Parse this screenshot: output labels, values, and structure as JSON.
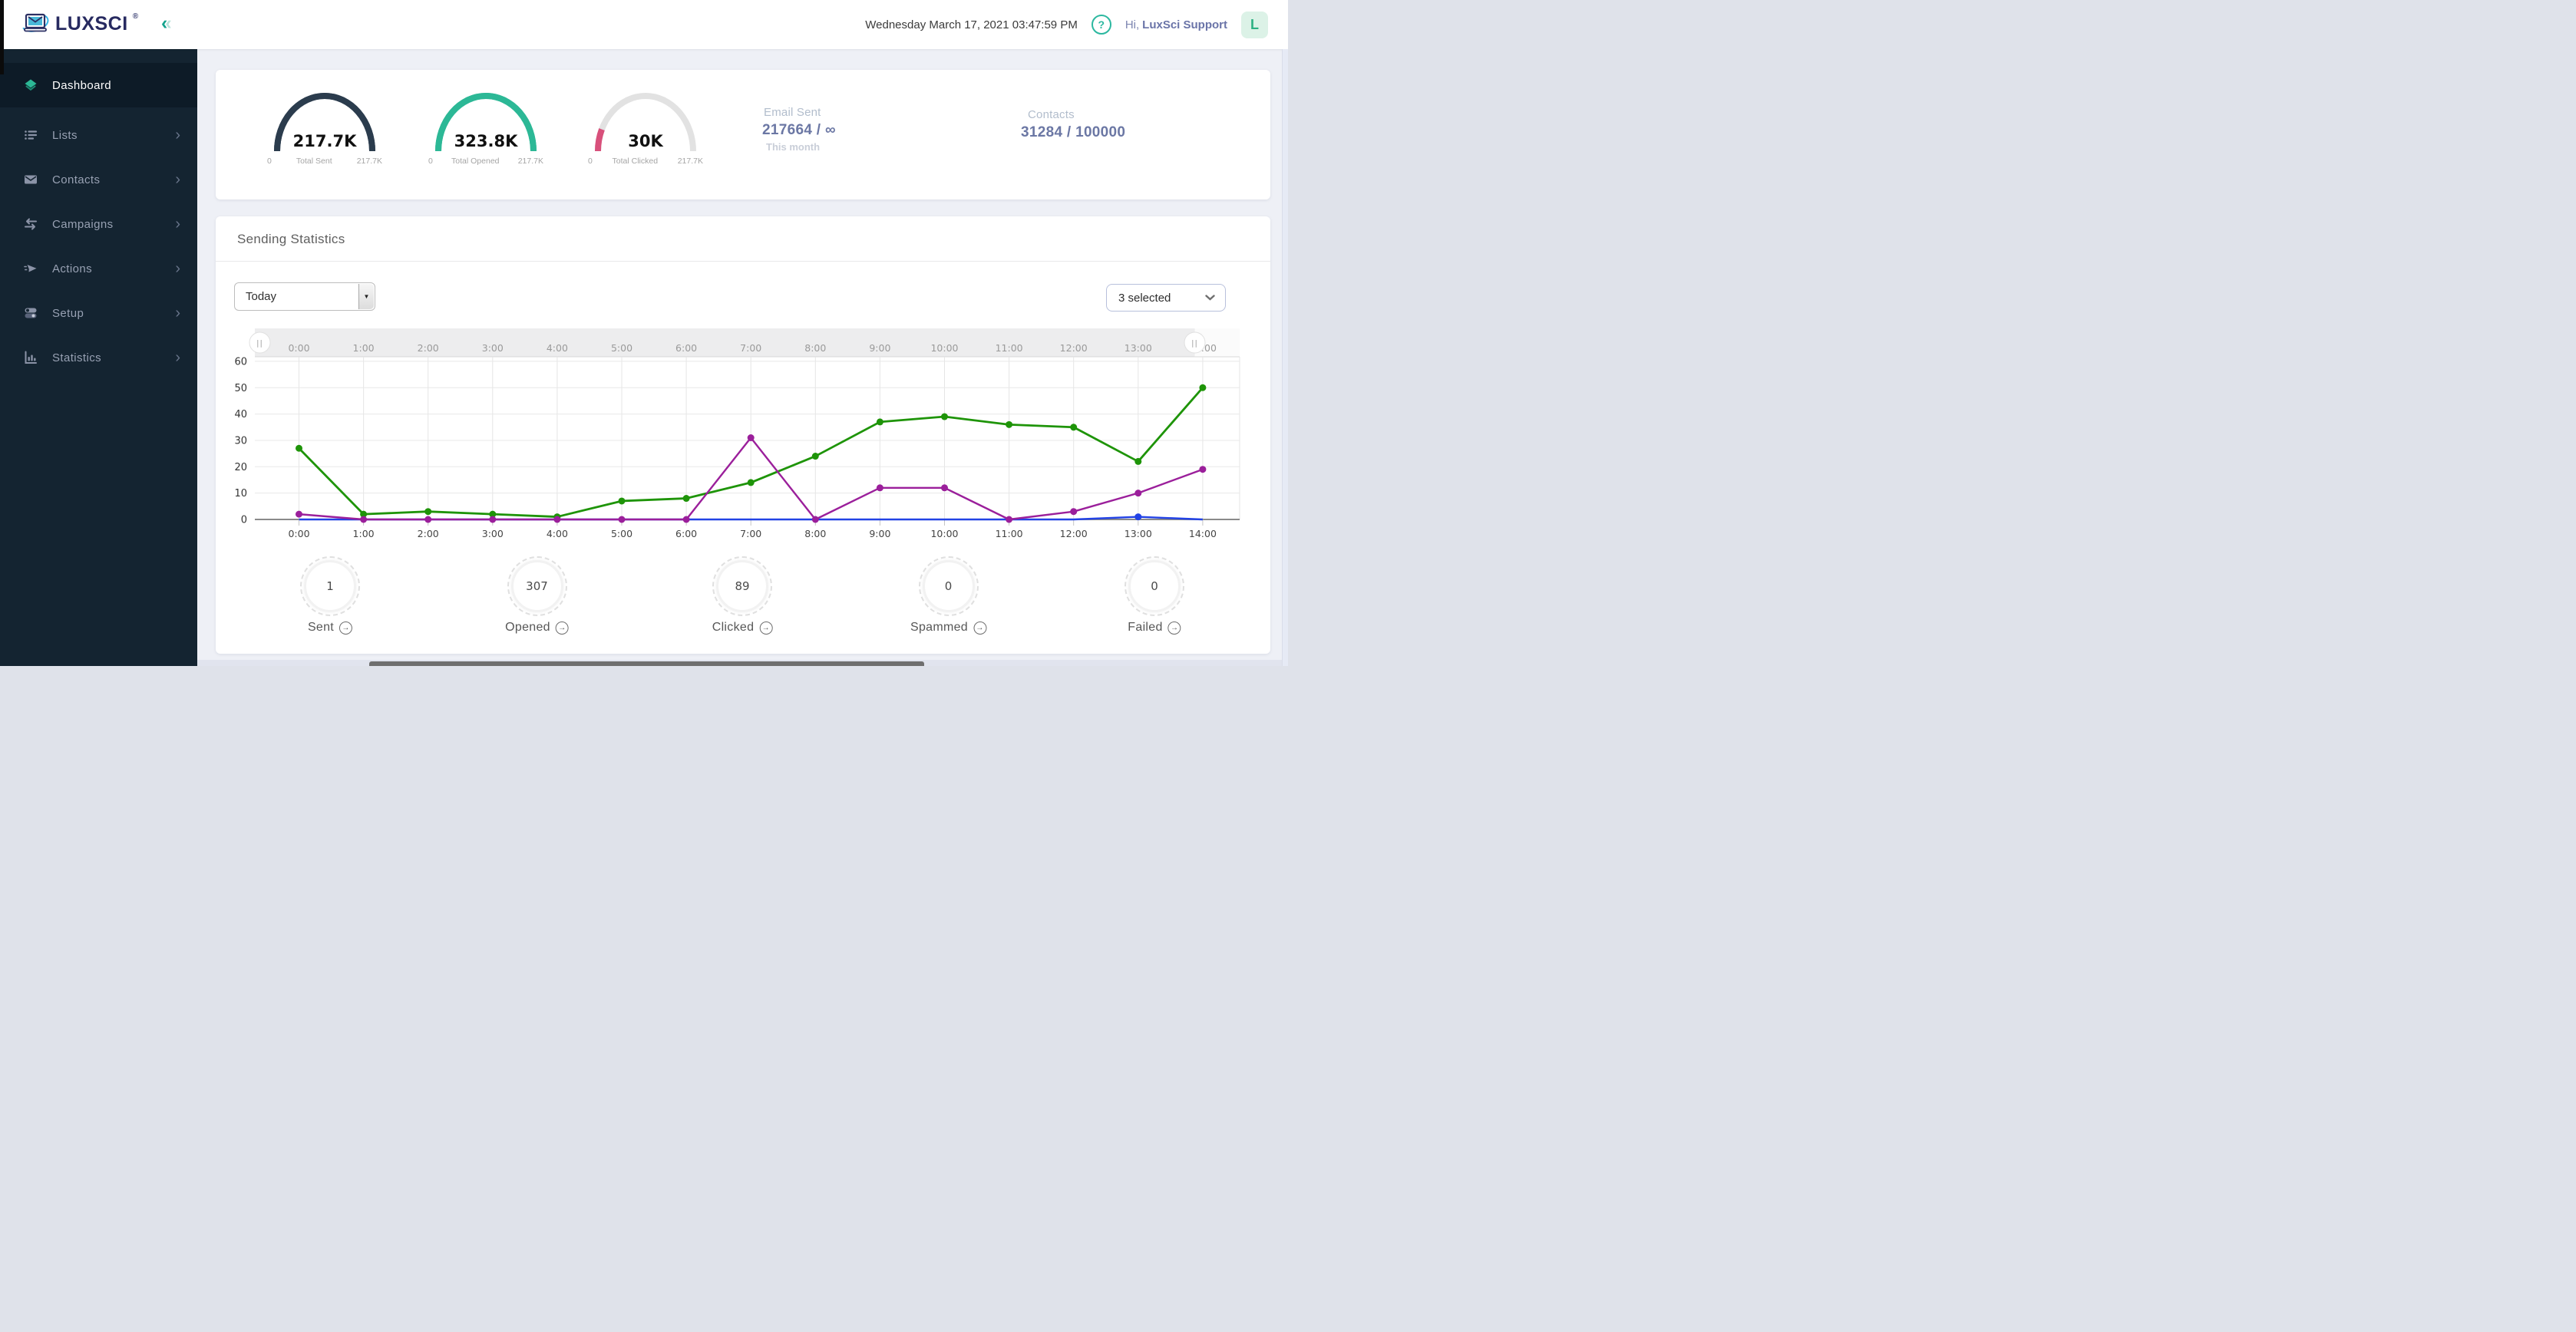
{
  "header": {
    "brand": "LUXSCI",
    "brand_reg": "®",
    "datetime": "Wednesday March 17, 2021 03:47:59 PM",
    "help_glyph": "?",
    "greeting": "Hi,",
    "username": "LuxSci Support",
    "avatar_letter": "L",
    "brand_navy": "#272a60",
    "brand_teal": "#2cb896"
  },
  "sidebar": {
    "items": [
      {
        "label": "Dashboard",
        "icon": "layers-icon",
        "active": true,
        "chevron": false
      },
      {
        "label": "Lists",
        "icon": "list-icon",
        "active": false,
        "chevron": true
      },
      {
        "label": "Contacts",
        "icon": "envelope-icon",
        "active": false,
        "chevron": true
      },
      {
        "label": "Campaigns",
        "icon": "arrows-icon",
        "active": false,
        "chevron": true
      },
      {
        "label": "Actions",
        "icon": "send-icon",
        "active": false,
        "chevron": true
      },
      {
        "label": "Setup",
        "icon": "toggles-icon",
        "active": false,
        "chevron": true
      },
      {
        "label": "Statistics",
        "icon": "chart-icon",
        "active": false,
        "chevron": true
      }
    ]
  },
  "overview": {
    "gauges": [
      {
        "value": "217.7K",
        "label": "Total Sent",
        "min": "0",
        "max": "217.7K",
        "color": "#2b3c4d",
        "track": "#2b3c4d",
        "fill_pct": 100
      },
      {
        "value": "323.8K",
        "label": "Total Opened",
        "min": "0",
        "max": "217.7K",
        "color": "#2cb896",
        "track": "#2cb896",
        "fill_pct": 100
      },
      {
        "value": "30K",
        "label": "Total Clicked",
        "min": "0",
        "max": "217.7K",
        "color": "#d8507b",
        "track": "#e2e2e2",
        "fill_pct": 13.8
      }
    ],
    "email_sent": {
      "label": "Email Sent",
      "value": "217664",
      "separator": "/",
      "quota": "∞",
      "period": "This month"
    },
    "contacts": {
      "label": "Contacts",
      "value": "31284 / 100000"
    }
  },
  "panel": {
    "title": "Sending Statistics",
    "range_select_value": "Today",
    "series_select_value": "3 selected"
  },
  "chart_data": {
    "type": "line",
    "x_labels": [
      "0:00",
      "1:00",
      "2:00",
      "3:00",
      "4:00",
      "5:00",
      "6:00",
      "7:00",
      "8:00",
      "9:00",
      "10:00",
      "11:00",
      "12:00",
      "13:00",
      "14:00"
    ],
    "ylim": [
      0,
      60
    ],
    "yticks": [
      0,
      10,
      20,
      30,
      40,
      50,
      60
    ],
    "grid": true,
    "legend": "hidden (3 selected)",
    "slider_handle_glyph": "||",
    "series": [
      {
        "name": "Sent",
        "color": "#2242e5",
        "values": [
          0,
          0,
          0,
          0,
          0,
          0,
          0,
          0,
          0,
          0,
          0,
          0,
          0,
          1,
          0
        ]
      },
      {
        "name": "Opened",
        "color": "#1e9408",
        "values": [
          27,
          2,
          3,
          2,
          1,
          7,
          8,
          14,
          24,
          37,
          39,
          36,
          35,
          22,
          50
        ]
      },
      {
        "name": "Clicked",
        "color": "#9b1f9b",
        "values": [
          2,
          0,
          0,
          0,
          0,
          0,
          0,
          31,
          0,
          12,
          12,
          0,
          3,
          10,
          19
        ]
      }
    ]
  },
  "summary": {
    "arrow_glyph": "→",
    "items": [
      {
        "value": "1",
        "label": "Sent"
      },
      {
        "value": "307",
        "label": "Opened"
      },
      {
        "value": "89",
        "label": "Clicked"
      },
      {
        "value": "0",
        "label": "Spammed"
      },
      {
        "value": "0",
        "label": "Failed"
      }
    ]
  }
}
